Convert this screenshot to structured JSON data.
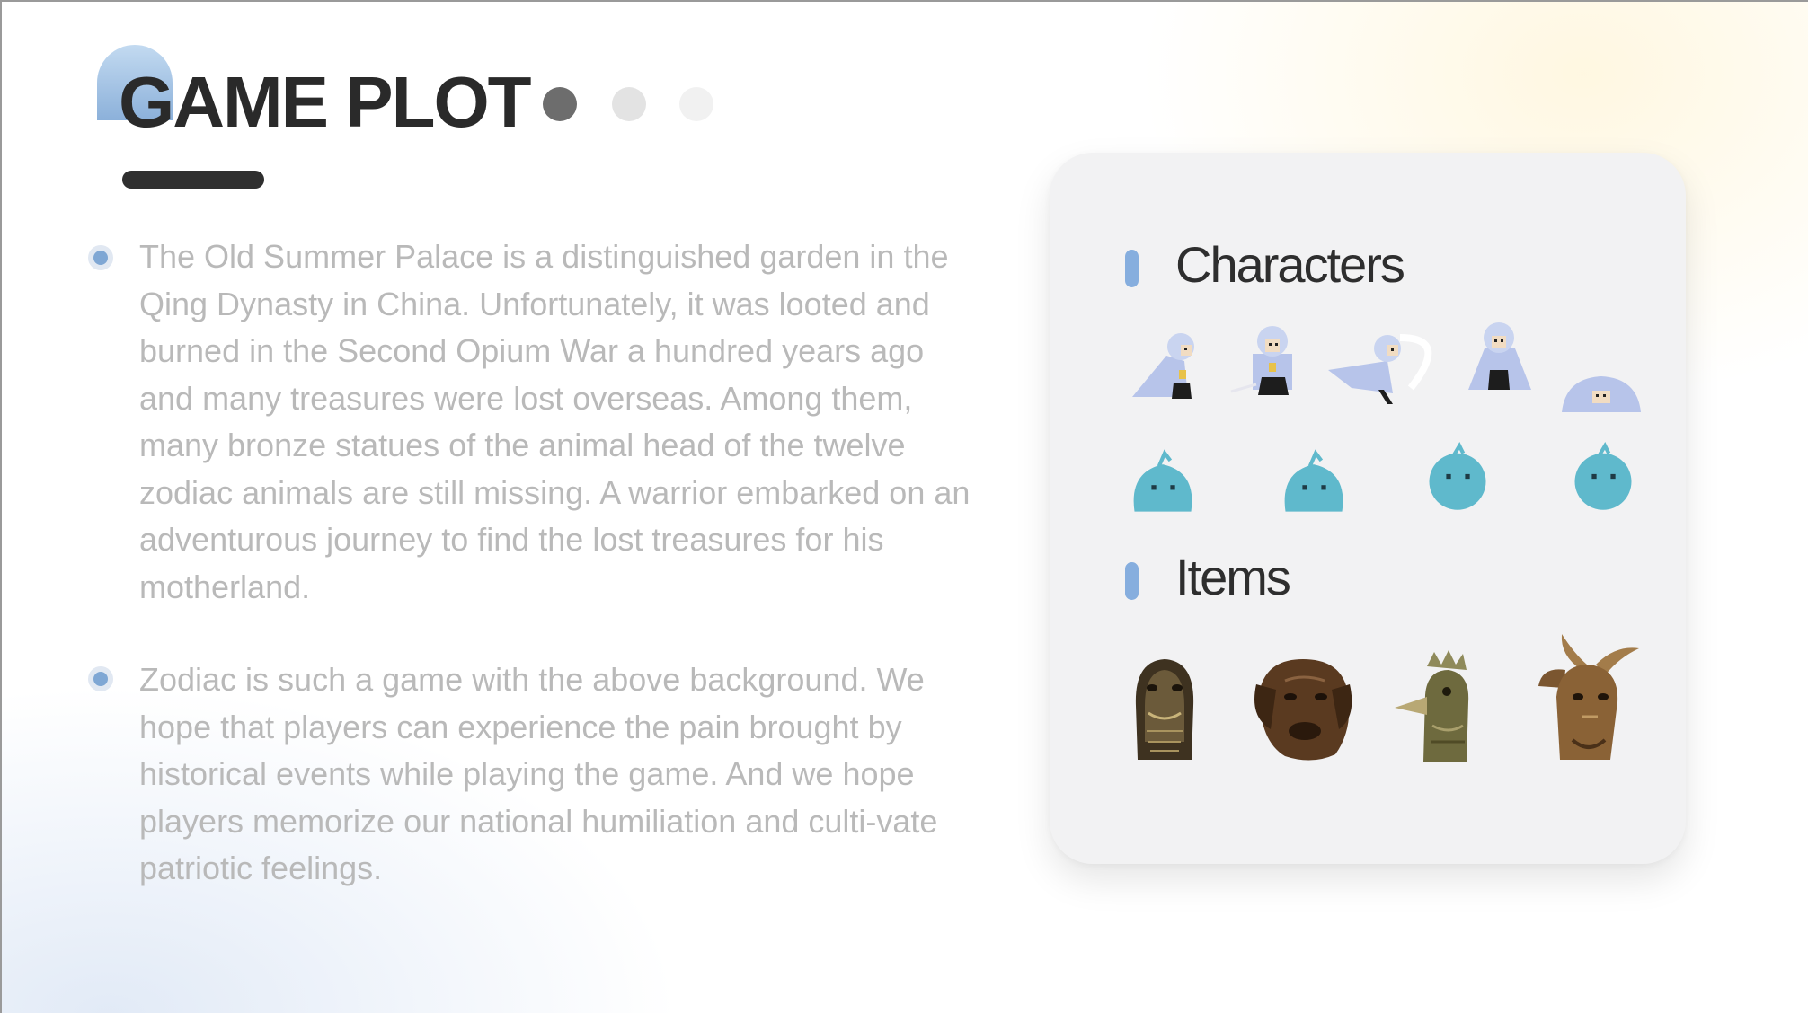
{
  "header": {
    "title": "GAME PLOT",
    "page_indicator": {
      "total": 3,
      "active": 1
    }
  },
  "paragraphs": [
    "The Old Summer Palace is a distinguished garden in the Qing Dynasty in China. Unfortunately, it was looted and burned in the Second Opium War a hundred years ago and many treasures were lost overseas. Among them, many bronze statues of the animal head of the twelve zodiac animals are still missing. A warrior embarked on an adventurous journey to find the lost treasures for his motherland.",
    "Zodiac is such a game with the above background. We hope that players can experience the pain brought by historical events while playing the game. And we hope players memorize our national humiliation and culti-vate patriotic feelings."
  ],
  "panel": {
    "characters_heading": "Characters",
    "items_heading": "Items",
    "warrior_sprites": [
      "warrior-walk-sprite-icon",
      "warrior-stand-sprite-icon",
      "warrior-dash-sprite-icon",
      "warrior-idle-sprite-icon",
      "warrior-crouch-sprite-icon"
    ],
    "slime_sprites": [
      "slime-enemy-icon",
      "slime-enemy-icon",
      "slime-enemy-icon",
      "slime-enemy-icon"
    ],
    "items": [
      "snake-bronze-head-icon",
      "dog-bronze-head-icon",
      "rooster-bronze-head-icon",
      "goat-bronze-head-icon"
    ]
  },
  "colors": {
    "accent": "#86aede",
    "title": "#2a2a2a",
    "body_text": "#b9b9b9",
    "warrior_cloak": "#b7c4ea",
    "slime": "#5fb9cc",
    "bronze": "#6b4a2b"
  }
}
